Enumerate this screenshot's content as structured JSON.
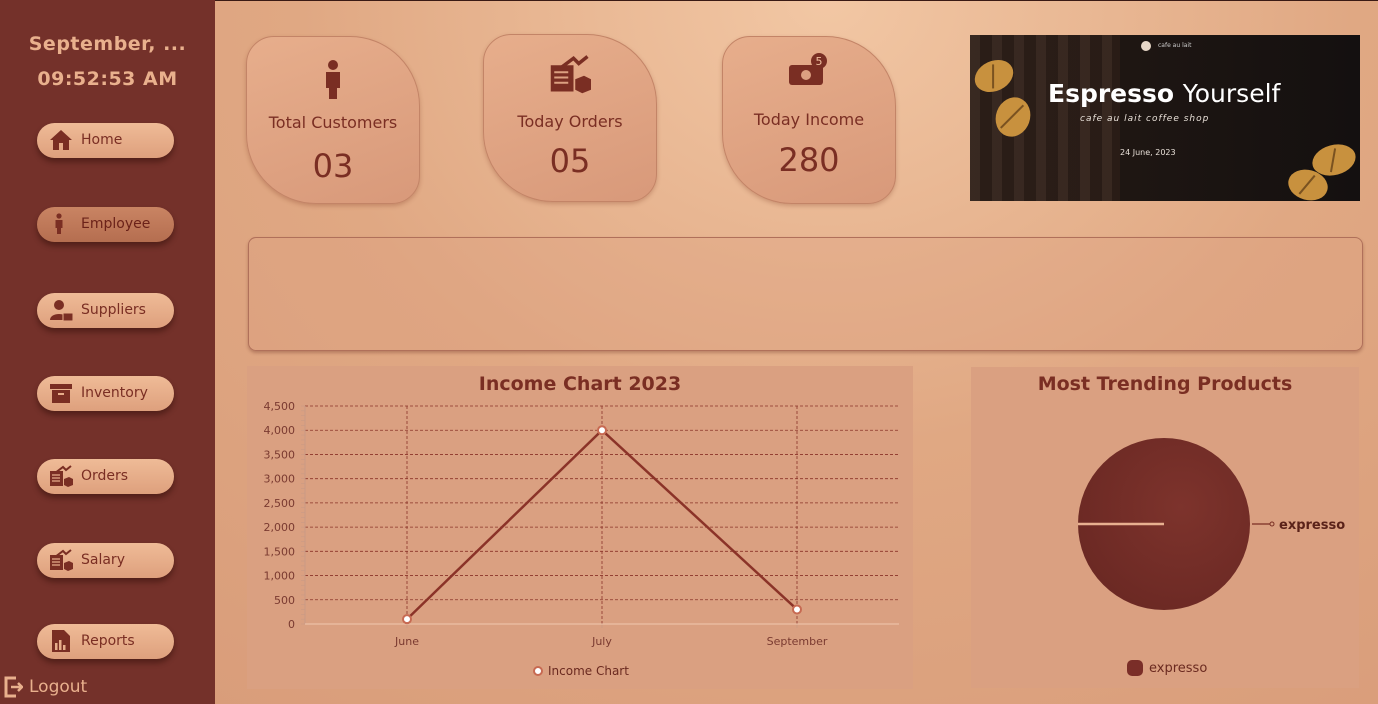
{
  "sidebar": {
    "date": "September, ...",
    "time": "09:52:53 AM",
    "items": [
      {
        "label": "Home",
        "icon": "home-icon"
      },
      {
        "label": "Employee",
        "icon": "person-icon"
      },
      {
        "label": "Suppliers",
        "icon": "supplier-icon"
      },
      {
        "label": "Inventory",
        "icon": "box-icon"
      },
      {
        "label": "Orders",
        "icon": "orders-icon"
      },
      {
        "label": "Salary",
        "icon": "salary-icon"
      },
      {
        "label": "Reports",
        "icon": "report-icon"
      }
    ],
    "logout": "Logout"
  },
  "cards": {
    "customers": {
      "label": "Total Customers",
      "value": "03"
    },
    "orders": {
      "label": "Today Orders",
      "value": "05"
    },
    "income": {
      "label": "Today Income",
      "value": "280",
      "badge": "5"
    }
  },
  "banner": {
    "brand": "cafe au lait",
    "title_bold": "Espresso",
    "title_rest": "Yourself",
    "subtitle": "cafe au lait coffee shop",
    "date": "24 June, 2023"
  },
  "colors": {
    "sidebar": "#74312a",
    "accent": "#7a2e23",
    "line": "#8b3328"
  },
  "chart_data": [
    {
      "type": "line",
      "title": "Income Chart 2023",
      "categories": [
        "June",
        "July",
        "September"
      ],
      "series": [
        {
          "name": "Income Chart",
          "values": [
            100,
            4000,
            300
          ]
        }
      ],
      "ylim": [
        0,
        4500
      ],
      "yticks": [
        "0",
        "500",
        "1,000",
        "1,500",
        "2,000",
        "2,500",
        "3,000",
        "3,500",
        "4,000",
        "4,500"
      ],
      "grid": true,
      "legend": "bottom"
    },
    {
      "type": "pie",
      "title": "Most Trending Products",
      "categories": [
        "expresso"
      ],
      "values": [
        100
      ],
      "legend": "bottom"
    }
  ]
}
